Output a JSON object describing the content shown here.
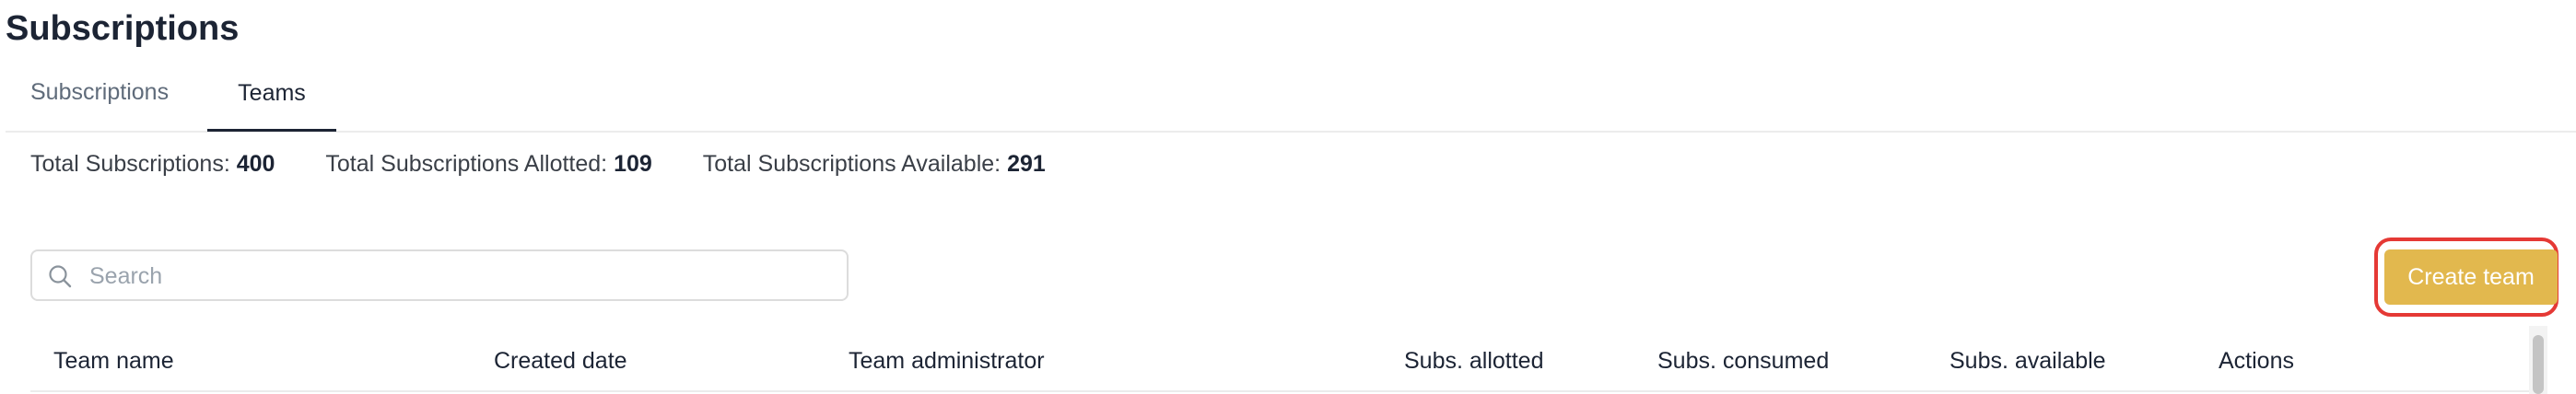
{
  "page": {
    "title": "Subscriptions"
  },
  "tabs": [
    {
      "label": "Subscriptions",
      "active": false
    },
    {
      "label": "Teams",
      "active": true
    }
  ],
  "totals": {
    "total_label": "Total Subscriptions:",
    "total_value": "400",
    "allotted_label": "Total Subscriptions Allotted:",
    "allotted_value": "109",
    "available_label": "Total Subscriptions Available:",
    "available_value": "291"
  },
  "search": {
    "placeholder": "Search",
    "value": ""
  },
  "toolbar": {
    "create_team_label": "Create team"
  },
  "table": {
    "columns": [
      "Team name",
      "Created date",
      "Team administrator",
      "Subs. allotted",
      "Subs. consumed",
      "Subs. available",
      "Actions"
    ]
  },
  "colors": {
    "accent_button": "#e2b84e",
    "highlight_border": "#e53935",
    "title_text": "#1c2434"
  }
}
